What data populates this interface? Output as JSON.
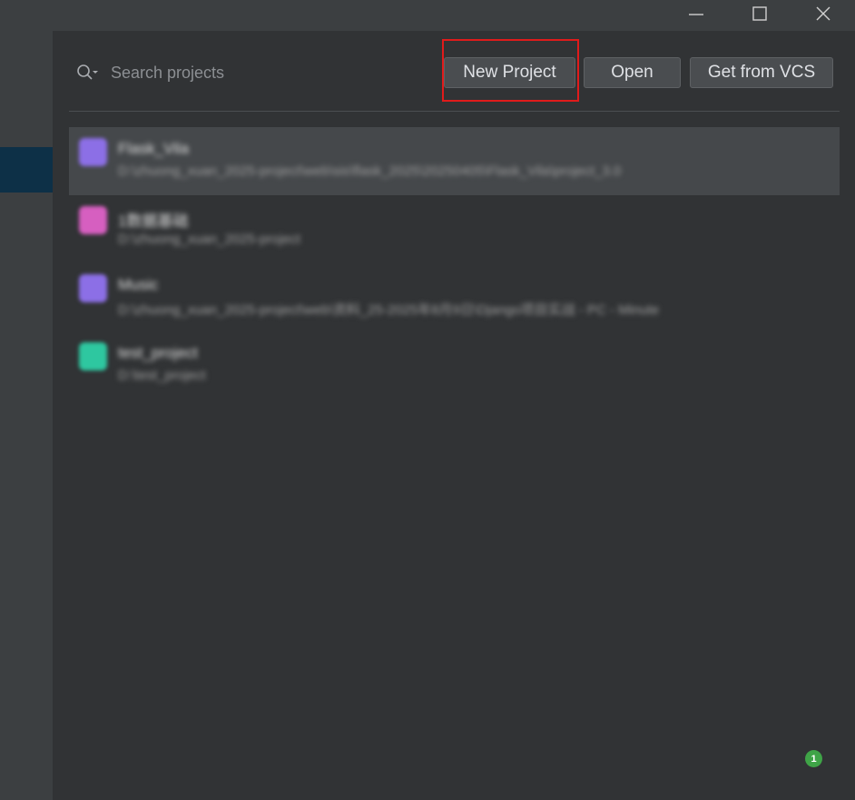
{
  "window": {
    "controls": {
      "minimize": "minimize-icon",
      "maximize": "maximize-icon",
      "close": "close-icon"
    }
  },
  "search": {
    "placeholder": "Search projects"
  },
  "toolbar": {
    "new_project_label": "New Project",
    "open_label": "Open",
    "vcs_label": "Get from VCS"
  },
  "projects": [
    {
      "name": "Flask_Vila",
      "path": "D:\\zhuong_xuan_2025-project\\web\\sis\\flask_2025\\20250405\\Flask_Vila\\project_3.0",
      "icon_color": "#8c6fe6"
    },
    {
      "name": "1数据基础",
      "path": "D:\\zhuong_xuan_2025-project",
      "icon_color": "#d65fc0"
    },
    {
      "name": "Music",
      "path": "D:\\zhuong_xuan_2025-project\\web\\资料_25-2025年8月9日\\Django项目实战 - PC - Minute",
      "icon_color": "#8c6fe6"
    },
    {
      "name": "test_project",
      "path": "D:\\test_project",
      "icon_color": "#2ec7a0"
    }
  ],
  "notifications": {
    "count": "1"
  },
  "colors": {
    "highlight": "#e01b1b",
    "selected_nav": "#0d3047",
    "badge": "#3fa447"
  }
}
